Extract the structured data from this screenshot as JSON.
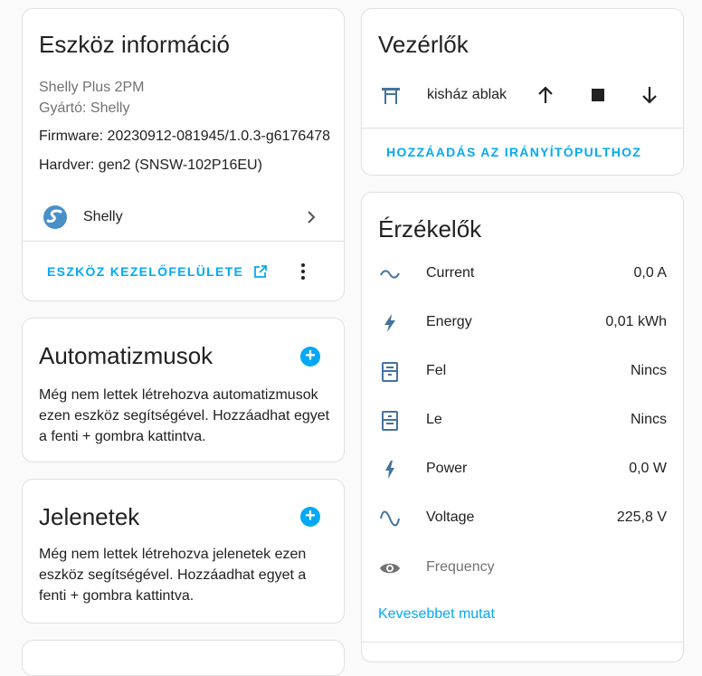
{
  "device_info": {
    "title": "Eszköz információ",
    "model": "Shelly Plus 2PM",
    "manufacturer": "Gyártó: Shelly",
    "firmware": "Firmware: 20230912-081945/1.0.3-g6176478",
    "hardware": "Hardver: gen2 (SNSW-102P16EU)",
    "integration_label": "Shelly",
    "visit_button": "ESZKÖZ KEZELŐFELÜLETE"
  },
  "automations": {
    "title": "Automatizmusok",
    "description": "Még nem lettek létrehozva automatizmusok ezen eszköz segítségével. Hozzáadhat egyet a fenti + gombra kattintva."
  },
  "scenes": {
    "title": "Jelenetek",
    "description": "Még nem lettek létrehozva jelenetek ezen eszköz segítségével. Hozzáadhat egyet a fenti + gombra kattintva."
  },
  "controls": {
    "title": "Vezérlők",
    "entity": "kisház ablak",
    "add_button": "HOZZÁADÁS AZ IRÁNYÍTÓPULTHOZ"
  },
  "sensors": {
    "title": "Érzékelők",
    "rows": [
      {
        "name": "Current",
        "value": "0,0 A",
        "icon": "current-ac-icon"
      },
      {
        "name": "Energy",
        "value": "0,01 kWh",
        "icon": "lightning-bolt-icon"
      },
      {
        "name": "Fel",
        "value": "Nincs",
        "icon": "window-shutter-up-icon"
      },
      {
        "name": "Le",
        "value": "Nincs",
        "icon": "window-shutter-down-icon"
      },
      {
        "name": "Power",
        "value": "0,0 W",
        "icon": "flash-icon"
      },
      {
        "name": "Voltage",
        "value": "225,8 V",
        "icon": "sine-wave-icon"
      }
    ],
    "hidden_row": {
      "name": "Frequency",
      "icon": "eye-icon"
    },
    "show_less": "Kevesebbet mutat"
  },
  "colors": {
    "accent": "#03a9f4",
    "icon": "#44739e",
    "muted": "#727272"
  }
}
